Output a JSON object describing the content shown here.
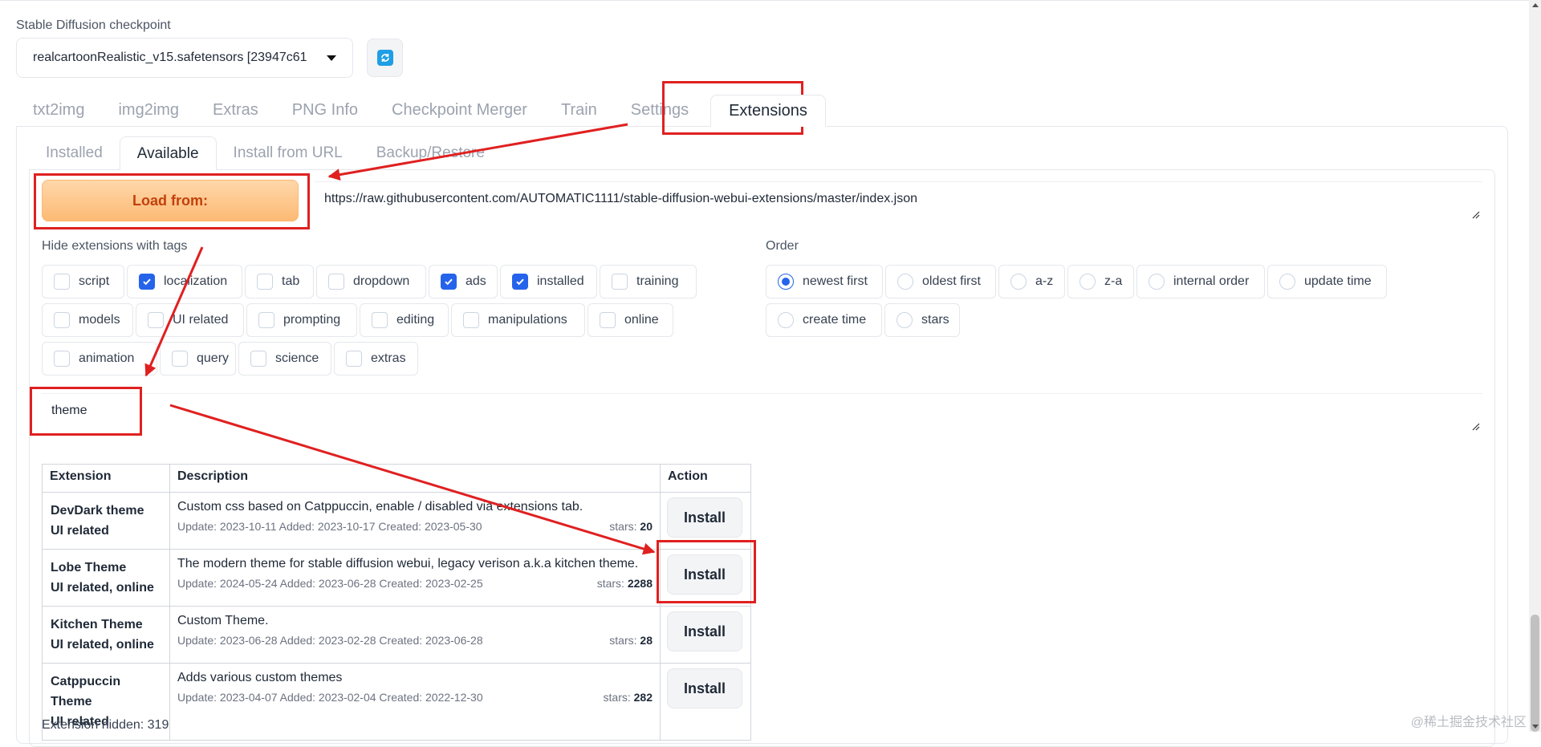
{
  "checkpoint": {
    "label": "Stable Diffusion checkpoint",
    "value": "realcartoonRealistic_v15.safetensors [23947c61"
  },
  "main_tabs": [
    "txt2img",
    "img2img",
    "Extras",
    "PNG Info",
    "Checkpoint Merger",
    "Train",
    "Settings",
    "Extensions"
  ],
  "sub_tabs": [
    "Installed",
    "Available",
    "Install from URL",
    "Backup/Restore"
  ],
  "load": {
    "button_label": "Load from:",
    "url": "https://raw.githubusercontent.com/AUTOMATIC1111/stable-diffusion-webui-extensions/master/index.json"
  },
  "hide_tags": {
    "label": "Hide extensions with tags",
    "items": [
      {
        "label": "script",
        "checked": false
      },
      {
        "label": "localization",
        "checked": true
      },
      {
        "label": "tab",
        "checked": false
      },
      {
        "label": "dropdown",
        "checked": false
      },
      {
        "label": "ads",
        "checked": true
      },
      {
        "label": "installed",
        "checked": true
      },
      {
        "label": "training",
        "checked": false
      },
      {
        "label": "models",
        "checked": false
      },
      {
        "label": "UI related",
        "checked": false
      },
      {
        "label": "prompting",
        "checked": false
      },
      {
        "label": "editing",
        "checked": false
      },
      {
        "label": "manipulations",
        "checked": false
      },
      {
        "label": "online",
        "checked": false
      },
      {
        "label": "animation",
        "checked": false
      },
      {
        "label": "query",
        "checked": false
      },
      {
        "label": "science",
        "checked": false
      },
      {
        "label": "extras",
        "checked": false
      }
    ]
  },
  "order": {
    "label": "Order",
    "selected": "newest first",
    "items": [
      "newest first",
      "oldest first",
      "a-z",
      "z-a",
      "internal order",
      "update time",
      "create time",
      "stars"
    ]
  },
  "search": {
    "value": "theme"
  },
  "table": {
    "headers": [
      "Extension",
      "Description",
      "Action"
    ],
    "rows": [
      {
        "name": "DevDark theme",
        "tags": "UI related",
        "description": "Custom css based on Catppuccin, enable / disabled via extensions tab.",
        "dates": "Update: 2023-10-11 Added: 2023-10-17 Created: 2023-05-30",
        "stars_label": "stars:",
        "stars": "20",
        "action": "Install"
      },
      {
        "name": "Lobe Theme",
        "tags": "UI related, online",
        "description": "The modern theme for stable diffusion webui, legacy verison a.k.a kitchen theme.",
        "dates": "Update: 2024-05-24 Added: 2023-06-28 Created: 2023-02-25",
        "stars_label": "stars:",
        "stars": "2288",
        "action": "Install"
      },
      {
        "name": "Kitchen Theme",
        "tags": "UI related, online",
        "description": "Custom Theme.",
        "dates": "Update: 2023-06-28 Added: 2023-02-28 Created: 2023-06-28",
        "stars_label": "stars:",
        "stars": "28",
        "action": "Install"
      },
      {
        "name": "Catppuccin Theme",
        "tags": "UI related",
        "description": "Adds various custom themes",
        "dates": "Update: 2023-04-07 Added: 2023-02-04 Created: 2022-12-30",
        "stars_label": "stars:",
        "stars": "282",
        "action": "Install"
      }
    ]
  },
  "hidden_count": "Extension hidden: 319",
  "watermark": "@稀土掘金技术社区",
  "colors": {
    "accent": "#2563eb",
    "load_button_text": "#c2410c",
    "annotation": "#e02020"
  }
}
